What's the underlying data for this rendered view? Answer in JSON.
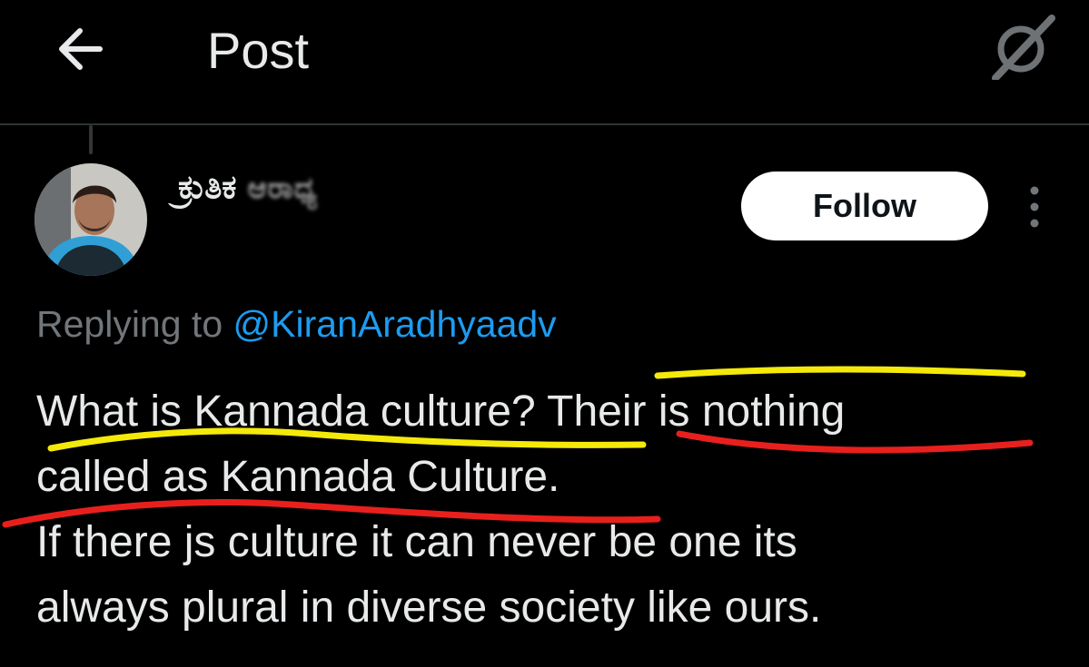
{
  "header": {
    "back_icon": "arrow-left-icon",
    "title": "Post",
    "brand_icon": "grok-icon"
  },
  "post": {
    "author": {
      "display_name": "ಕ್ರುತಿಕ",
      "display_name_redacted": "ಆರಾಧ್ಯ",
      "avatar_icon": "user-avatar"
    },
    "follow_label": "Follow",
    "more_icon": "more-vertical-icon",
    "replying_prefix": "Replying to",
    "replying_handle": "@KiranAradhyaadv",
    "text_lines": [
      "What is Kannada culture? Their is nothing",
      "called as Kannada Culture.",
      "If there js culture it can never be one its",
      "always plural in diverse society like ours."
    ]
  },
  "colors": {
    "background": "#000000",
    "text": "#e7e9ea",
    "muted": "#71767b",
    "link": "#1d9bf0",
    "highlight_yellow": "#f5e90a",
    "highlight_red": "#e8201d"
  }
}
